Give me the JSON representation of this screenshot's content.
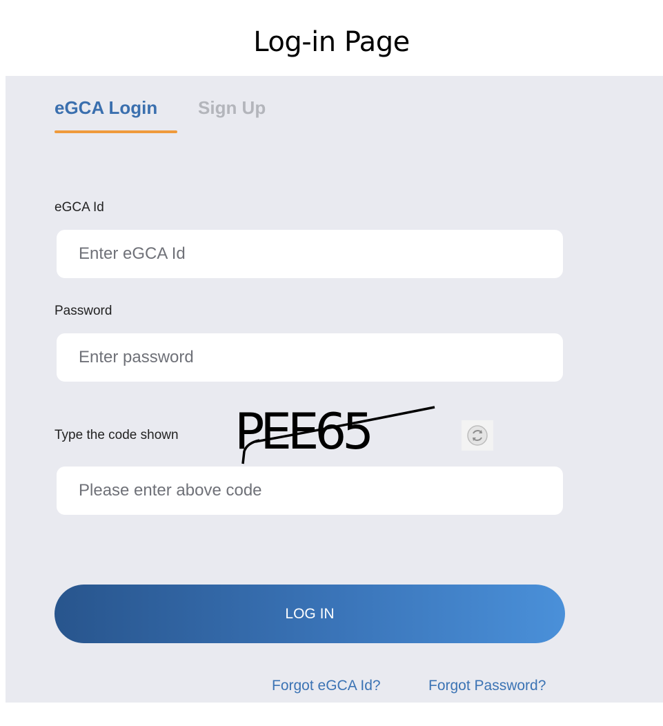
{
  "heading": "Log-in Page",
  "tabs": {
    "login": "eGCA Login",
    "signup": "Sign Up"
  },
  "form": {
    "egca_id_label": "eGCA Id",
    "egca_id_placeholder": "Enter eGCA Id",
    "password_label": "Password",
    "password_placeholder": "Enter password",
    "captcha_label": "Type the code shown",
    "captcha_code": "PEE65",
    "captcha_placeholder": "Please enter above code",
    "login_button": "LOG IN"
  },
  "links": {
    "forgot_id": "Forgot eGCA Id?",
    "forgot_password": "Forgot Password?"
  },
  "colors": {
    "panel_bg": "#e9eaf0",
    "tab_active": "#3a6fae",
    "tab_inactive": "#b3b5bb",
    "tab_underline": "#ef9a3c",
    "link": "#3b73b4",
    "button_gradient_start": "#28558d",
    "button_gradient_end": "#4a90d9"
  },
  "icons": {
    "captcha_refresh": "refresh-icon"
  }
}
